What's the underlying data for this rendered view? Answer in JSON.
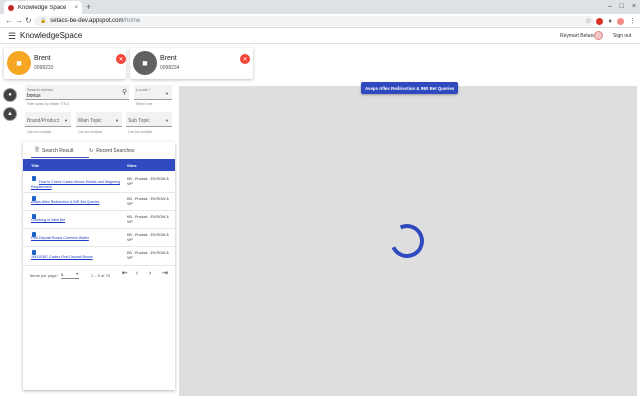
{
  "browser": {
    "tab_title": "Knowledge Space",
    "tab_close": "×",
    "new_tab": "+",
    "window_controls": [
      "–",
      "□",
      "×"
    ],
    "url_host": "setacs-be-dev.appspot.com",
    "url_path": "/home",
    "icons": [
      "back-icon",
      "forward-icon",
      "reload-icon",
      "lock-icon",
      "star-icon",
      "extension-icon",
      "puzzle-icon",
      "profile-icon",
      "menu-icon"
    ]
  },
  "header": {
    "title": "KnowledgeSpace",
    "user_name": "Reymart Betana",
    "sign_out": "Sign out"
  },
  "customers": [
    {
      "name": "Brent",
      "id": "0098233",
      "color": "#f5a623",
      "active": true
    },
    {
      "name": "Brent",
      "id": "0098234",
      "color": "#616161",
      "active": false
    }
  ],
  "search": {
    "query_label": "Search entries",
    "query_value": "bonus",
    "query_hint": "Filter posts by article TITLE",
    "locale_label": "Locale *",
    "locale_hint": "Select one",
    "brand_placeholder": "Brand/Product",
    "brand_hint": "Can be multiple",
    "main_topic_placeholder": "Main Topic",
    "main_topic_hint": "Can be multiple",
    "sub_topic_placeholder": "Sub Topic",
    "sub_topic_hint": "Can be multiple"
  },
  "results": {
    "tab_search": "Search Result",
    "tab_recent": "Recent Searches",
    "col_title": "Title",
    "col_sites": "Sites",
    "rows": [
      {
        "title": "How to Check Casino Bonus Details and Wagering Requirement",
        "site": "KB - Product - EN ROW & VIP"
      },
      {
        "title": "Aveps Aflex Redirection & INR Bet Queries",
        "site": "KB - Product - EN ROW & VIP"
      },
      {
        "title": "Checking of Valid Bet",
        "site": "KB - Product - EN ROW & VIP"
      },
      {
        "title": "First Deposit Bonus Common Wallet",
        "site": "KB - Product - EN ROW & VIP"
      },
      {
        "title": "XM110387 Casino First Deposit Bonus",
        "site": "KB - Product - EN ROW & VIP"
      }
    ],
    "items_per_page_label": "Items per page:",
    "items_per_page_value": "5",
    "range": "1 – 5 of 75"
  },
  "viewer": {
    "doc_title": "Aveps Aflex Redirection & INR Bet Queries",
    "background": "#dedede",
    "accent": "#2f4abf"
  }
}
